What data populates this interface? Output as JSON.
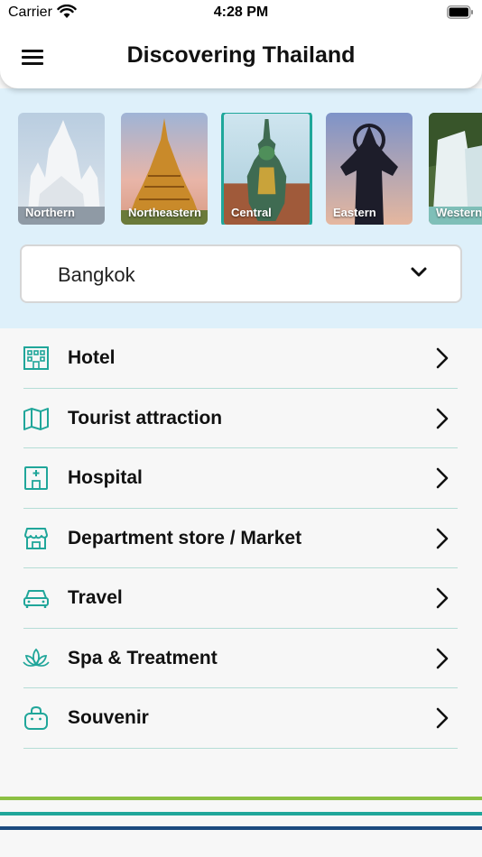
{
  "status_bar": {
    "carrier": "Carrier",
    "time": "4:28 PM"
  },
  "header": {
    "title": "Discovering Thailand"
  },
  "regions": [
    {
      "label": "Northern",
      "selected": false
    },
    {
      "label": "Northeastern",
      "selected": false
    },
    {
      "label": "Central",
      "selected": true
    },
    {
      "label": "Eastern",
      "selected": false
    },
    {
      "label": "Western",
      "selected": false
    }
  ],
  "province_select": {
    "value": "Bangkok"
  },
  "categories": [
    {
      "label": "Hotel",
      "icon": "hotel-icon"
    },
    {
      "label": "Tourist attraction",
      "icon": "map-icon"
    },
    {
      "label": "Hospital",
      "icon": "hospital-icon"
    },
    {
      "label": "Department store / Market",
      "icon": "store-icon"
    },
    {
      "label": "Travel",
      "icon": "car-icon"
    },
    {
      "label": "Spa & Treatment",
      "icon": "lotus-icon"
    },
    {
      "label": "Souvenir",
      "icon": "bag-icon"
    }
  ],
  "colors": {
    "accent": "#1fa79a",
    "panel_bg": "#def0fa",
    "stripe_green": "#8cc043",
    "stripe_teal": "#20a69a",
    "stripe_navy": "#1b4a7f"
  }
}
